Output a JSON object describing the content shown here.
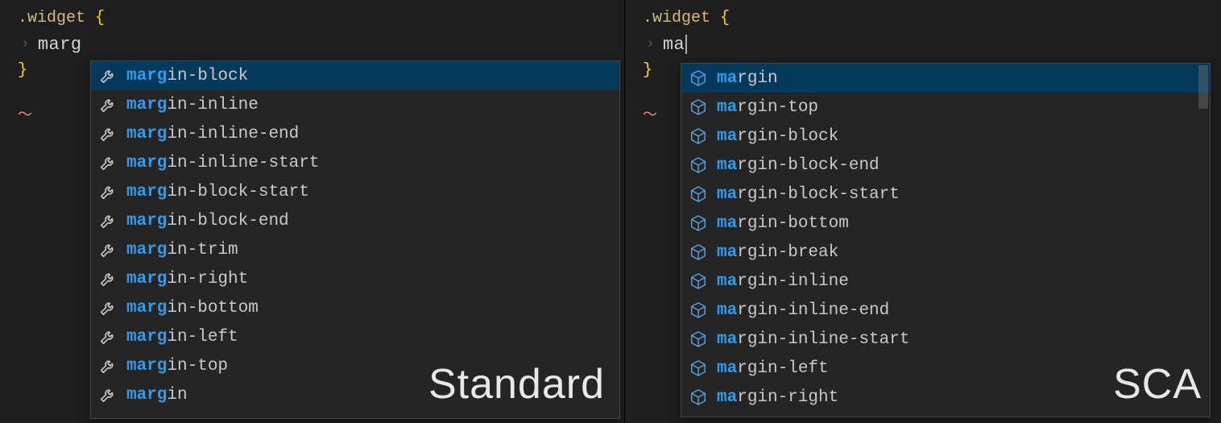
{
  "left": {
    "code_line1_selector": ".widget",
    "code_line1_open": " {",
    "typed": "marg",
    "close_brace": "}",
    "watermark": "Standard",
    "match_len": 4,
    "icon": "wrench",
    "suggestions": [
      "margin-block",
      "margin-inline",
      "margin-inline-end",
      "margin-inline-start",
      "margin-block-start",
      "margin-block-end",
      "margin-trim",
      "margin-right",
      "margin-bottom",
      "margin-left",
      "margin-top",
      "margin"
    ],
    "selected_index": 0
  },
  "right": {
    "code_line1_selector": ".widget",
    "code_line1_open": " {",
    "typed": "ma",
    "close_brace": "}",
    "watermark": "SCA",
    "match_len": 2,
    "icon": "cube",
    "has_scrollbar": true,
    "suggestions": [
      "margin",
      "margin-top",
      "margin-block",
      "margin-block-end",
      "margin-block-start",
      "margin-bottom",
      "margin-break",
      "margin-inline",
      "margin-inline-end",
      "margin-inline-start",
      "margin-left",
      "margin-right"
    ],
    "selected_index": 0
  },
  "icons": {
    "wrench_color": "#c5c5c5",
    "cube_color": "#5aa0d8"
  }
}
